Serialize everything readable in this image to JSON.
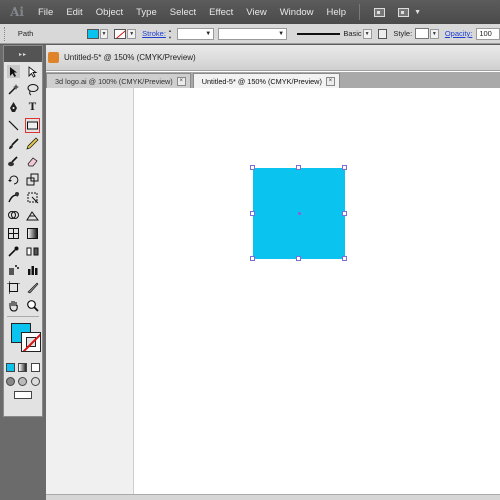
{
  "menubar": {
    "logo": "Ai",
    "items": [
      "File",
      "Edit",
      "Object",
      "Type",
      "Select",
      "Effect",
      "View",
      "Window",
      "Help"
    ]
  },
  "control_bar": {
    "selection_label": "Path",
    "fill_color": "#0ac3ef",
    "stroke_label": "Stroke:",
    "brush_label": "Basic",
    "style_label": "Style:",
    "opacity_label": "Opacity:",
    "opacity_value": "100"
  },
  "document": {
    "window_title": "Untitled-5* @ 150% (CMYK/Preview)",
    "tabs": [
      {
        "label": "3d logo.ai @ 100% (CMYK/Preview)",
        "active": false
      },
      {
        "label": "Untitled-5* @ 150% (CMYK/Preview)",
        "active": true
      }
    ],
    "tab_close_glyph": "×"
  },
  "canvas": {
    "object_type": "rectangle",
    "object_fill": "#0ac3ef",
    "selection_color": "#7b6fd6"
  },
  "tools": {
    "fill_color": "#0ac3ef",
    "active_tool": "rectangle-tool",
    "type_glyph": "T"
  }
}
